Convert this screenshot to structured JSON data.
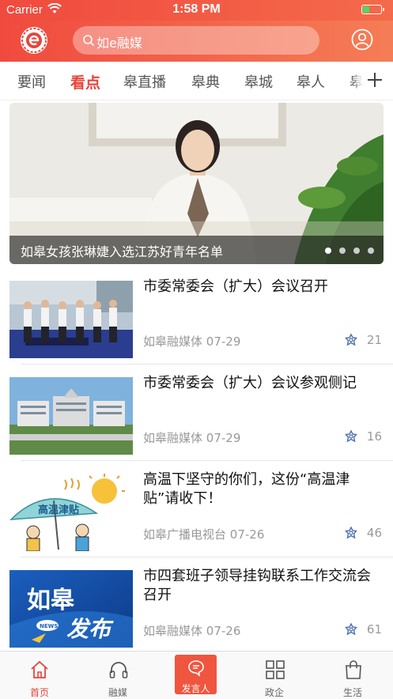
{
  "status": {
    "carrier": "Carrier",
    "time": "1:58 PM"
  },
  "search": {
    "placeholder": "如e融媒"
  },
  "tabs": [
    {
      "label": "要闻"
    },
    {
      "label": "看点",
      "active": true
    },
    {
      "label": "皋直播"
    },
    {
      "label": "皋典"
    },
    {
      "label": "皋城"
    },
    {
      "label": "皋人"
    },
    {
      "label": "皋风"
    }
  ],
  "banner": {
    "caption": "如皋女孩张琳婕入选江苏好青年名单",
    "pages": 4,
    "current_page": 1
  },
  "news": [
    {
      "title": "市委常委会（扩大）会议召开",
      "source": "如皋融媒体",
      "date": "07-29",
      "likes": "21"
    },
    {
      "title": "市委常委会（扩大）会议参观侧记",
      "source": "如皋融媒体",
      "date": "07-29",
      "likes": "16"
    },
    {
      "title": "高温下坚守的你们，这份“高温津贴”请收下！",
      "source": "如皋广播电视台",
      "date": "07-26",
      "likes": "46"
    },
    {
      "title": "市四套班子领导挂钩联系工作交流会召开",
      "source": "如皋融媒体",
      "date": "07-26",
      "likes": "61"
    }
  ],
  "thumb_text": {
    "heat": "高温津贴",
    "brand1": "如皋",
    "brand2": "发布",
    "news_badge": "NEWS"
  },
  "bottom_nav": [
    {
      "label": "首页",
      "icon": "home-icon",
      "active": true
    },
    {
      "label": "融媒",
      "icon": "headphones-icon"
    },
    {
      "label": "发言人",
      "icon": "chat-icon",
      "center": true
    },
    {
      "label": "政企",
      "icon": "grid-icon"
    },
    {
      "label": "生活",
      "icon": "bag-icon"
    }
  ],
  "colors": {
    "accent": "#e8443a",
    "header_gradient_start": "#f04a3e",
    "header_gradient_end": "#f57d56"
  }
}
